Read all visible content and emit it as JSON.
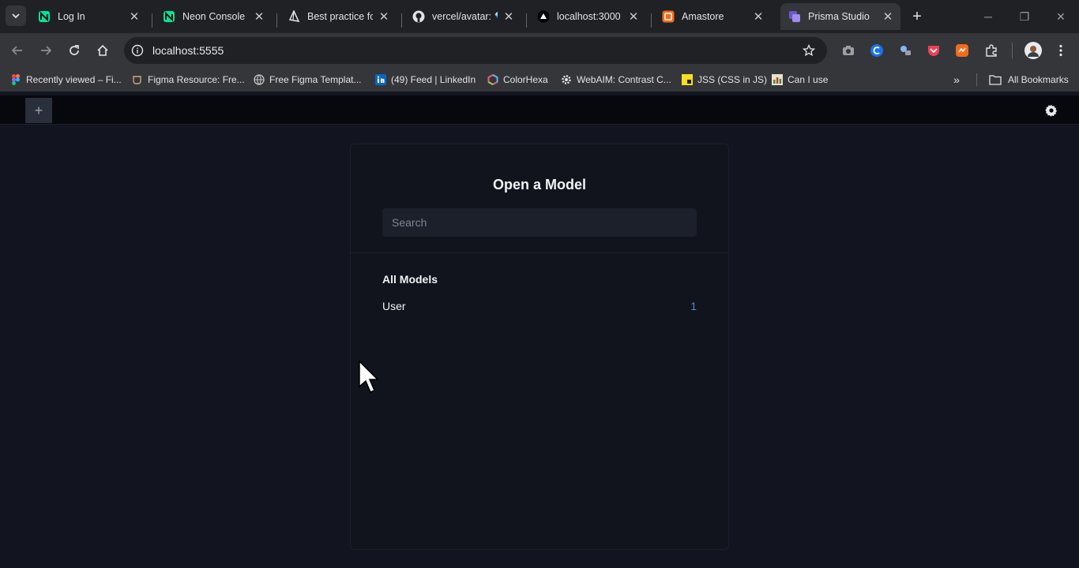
{
  "browser": {
    "tabs": [
      {
        "title": "Log In",
        "icon": "neon-icon",
        "active": false
      },
      {
        "title": "Neon Console",
        "icon": "neon-icon",
        "active": false
      },
      {
        "title": "Best practice for",
        "icon": "prisma-triangle-icon",
        "active": false
      },
      {
        "title": "vercel/avatar: 💎",
        "icon": "github-icon",
        "active": false
      },
      {
        "title": "localhost:3000",
        "icon": "triangle-icon",
        "active": false
      },
      {
        "title": "Amastore",
        "icon": "amastore-icon",
        "active": false
      },
      {
        "title": "Prisma Studio",
        "icon": "prisma-studio-icon",
        "active": true
      }
    ],
    "address": {
      "url": "localhost:5555"
    },
    "bookmarks": [
      {
        "label": "Recently viewed – Fi...",
        "icon": "figma-icon"
      },
      {
        "label": "Figma Resource: Fre...",
        "icon": "cup-icon"
      },
      {
        "label": "Free Figma Templat...",
        "icon": "globe-icon"
      },
      {
        "label": "(49) Feed | LinkedIn",
        "icon": "linkedin-icon"
      },
      {
        "label": "ColorHexa",
        "icon": "colorhexa-icon"
      },
      {
        "label": "WebAIM: Contrast C...",
        "icon": "gear-icon"
      },
      {
        "label": "JSS (CSS in JS)",
        "icon": "jss-icon"
      },
      {
        "label": "Can I use",
        "icon": "caniuse-icon"
      }
    ],
    "all_bookmarks_label": "All Bookmarks",
    "colors": {
      "tab_strip": "#202124",
      "toolbar": "#35363a",
      "omnibox": "#202124"
    }
  },
  "studio": {
    "panel_title": "Open a Model",
    "search": {
      "placeholder": "Search",
      "value": ""
    },
    "section_heading": "All Models",
    "models": [
      {
        "name": "User",
        "count": "1"
      }
    ],
    "colors": {
      "background": "#12151f",
      "header": "#07080d",
      "accent": "#5b86d6"
    }
  }
}
